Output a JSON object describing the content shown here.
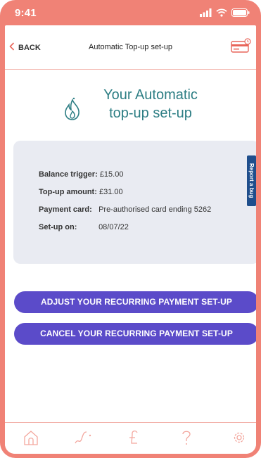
{
  "status_bar": {
    "time": "9:41",
    "icons": [
      "signal-icon",
      "wifi-icon",
      "battery-icon"
    ]
  },
  "header": {
    "back_label": "BACK",
    "title": "Automatic Top-up set-up",
    "right_icon": "credit-card-icon"
  },
  "main": {
    "heading_line1": "Your Automatic",
    "heading_line2": "top-up set-up",
    "heading_icon": "flame-icon",
    "summary": {
      "balance_trigger_label": "Balance trigger:",
      "balance_trigger_value": "£15.00",
      "topup_amount_label": "Top-up amount:",
      "topup_amount_value": "£31.00",
      "payment_card_label": "Payment card:",
      "payment_card_value": "Pre-authorised card ending 5262",
      "setup_on_label": "Set-up on:",
      "setup_on_value": "08/07/22"
    },
    "adjust_button": "ADJUST YOUR RECURRING PAYMENT SET-UP",
    "cancel_button": "CANCEL YOUR RECURRING PAYMENT SET-UP"
  },
  "report_bug_tab": "Report a bug",
  "bottom_nav": {
    "items": [
      "home-icon",
      "usage-graph-icon",
      "pound-icon",
      "help-icon",
      "settings-icon"
    ]
  },
  "colors": {
    "accent": "#f08276",
    "heading": "#2d7e84",
    "button": "#5b4bc9",
    "card_bg": "#e9ebf2",
    "report_tab": "#1f4e8c"
  }
}
